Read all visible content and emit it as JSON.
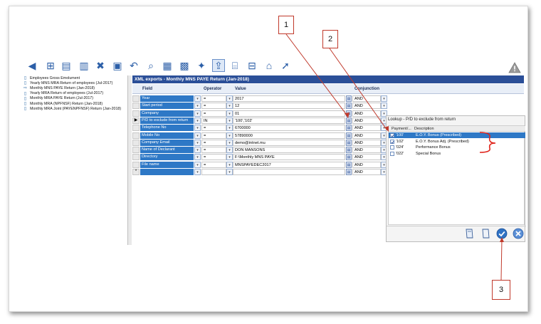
{
  "toolbar": {
    "icons": [
      "back-arrow-icon",
      "tree-icon",
      "document-icon",
      "documents-icon",
      "delete-doc-icon",
      "save-icon",
      "undo-icon",
      "find-icon",
      "print-icon",
      "settings-icon",
      "wand-icon",
      "export-icon",
      "preview-icon",
      "printer-icon",
      "home-icon",
      "run-icon"
    ]
  },
  "tree": {
    "items": [
      {
        "label": "Employees Gross Emolument",
        "icon": "doc-icon"
      },
      {
        "label": "Yearly MNS MRA Return of employees (Jul-2017)",
        "icon": "doc-icon"
      },
      {
        "label": "Monthly MNS PAYE Return (Jan-2018)",
        "icon": "arrow-icon"
      },
      {
        "label": "Yearly MRA Return of employees (Jul-2017)",
        "icon": "doc-icon"
      },
      {
        "label": "Monthly MRA PAYE Return (Jul-2017)",
        "icon": "doc-icon"
      },
      {
        "label": "Monthly MRA (NPFNSF) Return (Jan-2018)",
        "icon": "doc-icon"
      },
      {
        "label": "Monthly MRA Joint (PAYENPFNSF) Return (Jan-2018)",
        "icon": "doc-icon"
      }
    ]
  },
  "grid": {
    "title": "XML exports - Monthly MNS PAYE Return (Jan-2018)",
    "headers": {
      "field": "Field",
      "operator": "Operator",
      "value": "Value",
      "conjunction": "Conjunction"
    },
    "rows": [
      {
        "field": "Year",
        "operator": "=",
        "value": "2017",
        "conj": "AND",
        "marker": ""
      },
      {
        "field": "Start period",
        "operator": "=",
        "value": "12",
        "conj": "AND",
        "marker": ""
      },
      {
        "field": "Company",
        "operator": "=",
        "value": "01",
        "conj": "AND",
        "marker": ""
      },
      {
        "field": "P/D to exclude from return",
        "operator": "IN",
        "value": "'100','102'",
        "conj": "AND",
        "marker": "▶"
      },
      {
        "field": "Telephone No",
        "operator": "=",
        "value": "6700000",
        "conj": "AND",
        "marker": ""
      },
      {
        "field": "Mobile No",
        "operator": "=",
        "value": "57890000",
        "conj": "AND",
        "marker": ""
      },
      {
        "field": "Company Email",
        "operator": "=",
        "value": "demo@intnet.mu",
        "conj": "AND",
        "marker": ""
      },
      {
        "field": "Name of Declarant",
        "operator": "=",
        "value": "DON MANSONS",
        "conj": "AND",
        "marker": ""
      },
      {
        "field": "Directory",
        "operator": "=",
        "value": "F:\\Monthly MNS PAYE",
        "conj": "AND",
        "marker": ""
      },
      {
        "field": "File name",
        "operator": "=",
        "value": "MNSPAYEDEC2017",
        "conj": "AND",
        "marker": ""
      },
      {
        "field": "",
        "operator": "",
        "value": "",
        "conj": "AND",
        "marker": "*"
      }
    ]
  },
  "lookup": {
    "title": "Lookup - P/D to exclude from return",
    "headers": {
      "code": "Payment/...",
      "description": "Description"
    },
    "rows": [
      {
        "code": "'100'",
        "description": "E.O.Y. Bonus (Prescribed)",
        "checked": true
      },
      {
        "code": "'102'",
        "description": "E.O.Y. Bonus Adj. (Prescribed)",
        "checked": true
      },
      {
        "code": "'024'",
        "description": "Performance Bonus",
        "checked": false
      },
      {
        "code": "'022'",
        "description": "Special Bonus",
        "checked": false
      }
    ]
  },
  "callouts": {
    "c1": "1",
    "c2": "2",
    "c3": "3"
  },
  "colors": {
    "accent": "#2e78c6",
    "title_bar": "#2b4f98",
    "annotation": "#c0392b"
  }
}
